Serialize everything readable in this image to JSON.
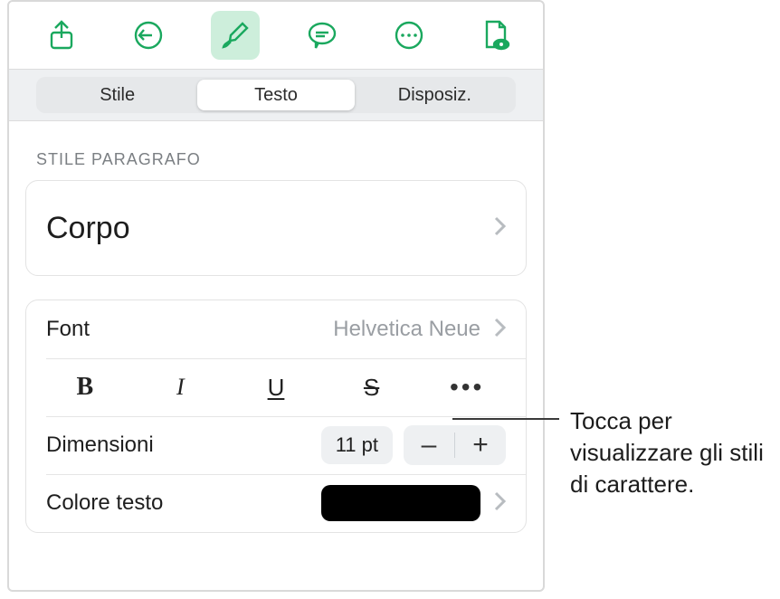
{
  "tabs": {
    "style": "Stile",
    "text": "Testo",
    "layout": "Disposiz.",
    "active": "text"
  },
  "sections": {
    "paragraph_style_label": "STILE PARAGRAFO"
  },
  "paragraph_style": {
    "name": "Corpo"
  },
  "font": {
    "label": "Font",
    "value": "Helvetica Neue"
  },
  "styles": {
    "bold": "B",
    "italic": "I",
    "underline": "U",
    "strike": "S",
    "more": "•••"
  },
  "size": {
    "label": "Dimensioni",
    "value": "11 pt",
    "minus": "–",
    "plus": "+"
  },
  "text_color": {
    "label": "Colore testo",
    "value": "#000000"
  },
  "callout": {
    "text": "Tocca per visualizzare gli stili di carattere."
  }
}
